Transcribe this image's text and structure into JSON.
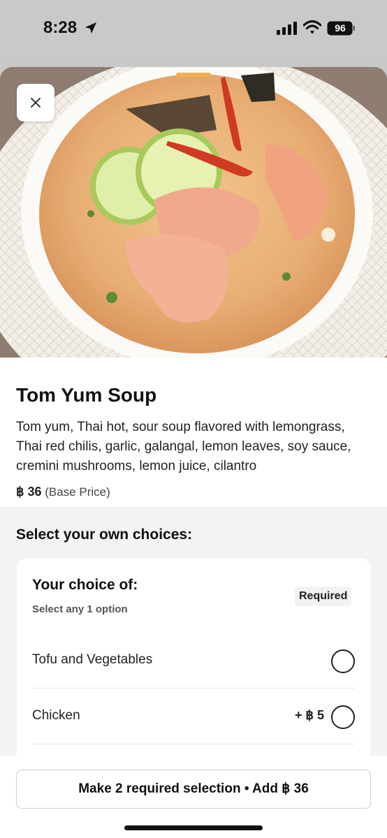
{
  "status_bar": {
    "time": "8:28",
    "battery": "96",
    "icons": [
      "location-arrow-icon",
      "cellular-signal-icon",
      "wifi-icon",
      "battery-icon"
    ]
  },
  "hero": {
    "image": "tom-yum-soup-photo",
    "close_icon": "close-icon"
  },
  "item": {
    "name": "Tom Yum Soup",
    "description": "Tom yum, Thai hot, sour soup flavored with lemongrass, Thai red chilis, garlic, galangal, lemon leaves, soy sauce, cremini mushrooms, lemon juice, cilantro",
    "price": "฿ 36",
    "price_note": "(Base Price)"
  },
  "choices": {
    "heading": "Select your own choices:",
    "group": {
      "title": "Your choice of:",
      "subtitle": "Select any 1 option",
      "badge": "Required",
      "options": [
        {
          "label": "Tofu and Vegetables",
          "price": ""
        },
        {
          "label": "Chicken",
          "price": "+ ฿ 5"
        }
      ]
    }
  },
  "footer": {
    "cta_label": "Make 2 required selection • Add ฿ 36"
  },
  "colors": {
    "accent_grabber": "#f0b050",
    "background_grey": "#f2f3f2"
  }
}
